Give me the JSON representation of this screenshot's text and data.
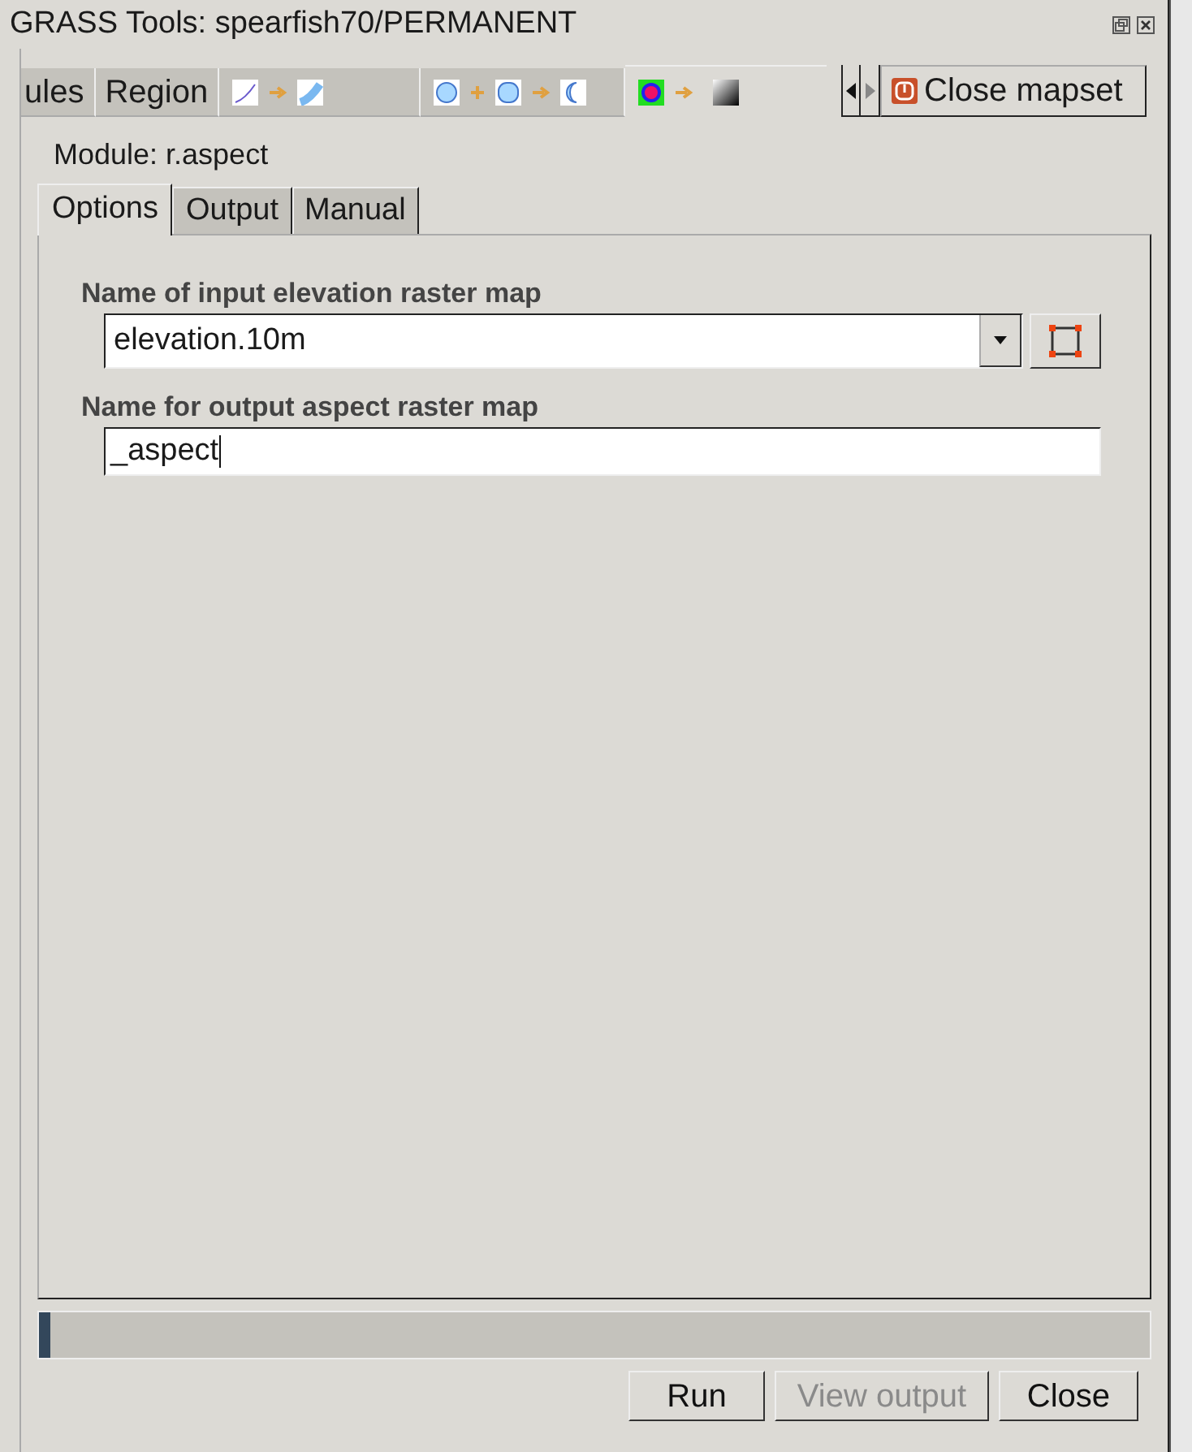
{
  "window": {
    "title": "GRASS Tools: spearfish70/PERMANENT"
  },
  "toolbox_tabs": [
    {
      "kind": "text",
      "label": "ules",
      "selected": false
    },
    {
      "kind": "text",
      "label": "Region",
      "selected": false
    },
    {
      "kind": "vector-lines",
      "selected": false
    },
    {
      "kind": "vector-areas",
      "selected": false
    },
    {
      "kind": "raster-color",
      "selected": true
    }
  ],
  "close_mapset_button": {
    "label": "Close mapset"
  },
  "module": {
    "label": "Module: r.aspect"
  },
  "tabs": [
    {
      "label": "Options",
      "selected": true
    },
    {
      "label": "Output",
      "selected": false
    },
    {
      "label": "Manual",
      "selected": false
    }
  ],
  "fields": [
    {
      "kind": "select",
      "label": "Name of input elevation raster map",
      "value": "elevation.10m"
    },
    {
      "kind": "text",
      "label": "Name for output aspect raster map",
      "value": "_aspect"
    }
  ],
  "progress": {
    "level": 0.01
  },
  "buttons": [
    {
      "label": "Run",
      "disabled": false
    },
    {
      "label": "View output",
      "disabled": true
    },
    {
      "label": "Close",
      "disabled": false
    }
  ]
}
